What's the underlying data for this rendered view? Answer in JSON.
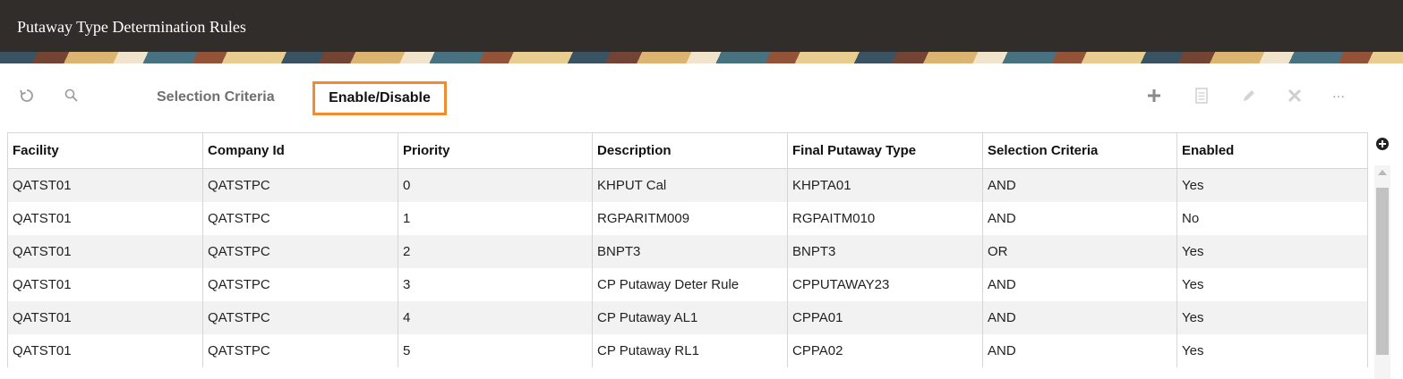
{
  "page": {
    "title": "Putaway Type Determination Rules"
  },
  "toolbar": {
    "refresh_icon": "refresh-icon",
    "search_icon": "search-icon",
    "tab_selection_criteria": "Selection Criteria",
    "tab_enable_disable": "Enable/Disable",
    "add_icon": "add-icon",
    "details_icon": "details-icon",
    "edit_icon": "edit-icon",
    "delete_icon": "delete-icon",
    "more_label": "···"
  },
  "colors": {
    "titlebar": "#312d2a",
    "active_tab_border": "#f28a2e",
    "row_stripe": "#f2f2f2"
  },
  "table": {
    "columns": [
      "Facility",
      "Company Id",
      "Priority",
      "Description",
      "Final Putaway Type",
      "Selection Criteria",
      "Enabled"
    ],
    "rows": [
      [
        "QATST01",
        "QATSTPC",
        "0",
        "KHPUT Cal",
        "KHPTA01",
        "AND",
        "Yes"
      ],
      [
        "QATST01",
        "QATSTPC",
        "1",
        "RGPARITM009",
        "RGPAITM010",
        "AND",
        "No"
      ],
      [
        "QATST01",
        "QATSTPC",
        "2",
        "BNPT3",
        "BNPT3",
        "OR",
        "Yes"
      ],
      [
        "QATST01",
        "QATSTPC",
        "3",
        "CP Putaway Deter Rule",
        "CPPUTAWAY23",
        "AND",
        "Yes"
      ],
      [
        "QATST01",
        "QATSTPC",
        "4",
        "CP Putaway AL1",
        "CPPA01",
        "AND",
        "Yes"
      ],
      [
        "QATST01",
        "QATSTPC",
        "5",
        "CP Putaway RL1",
        "CPPA02",
        "AND",
        "Yes"
      ]
    ]
  }
}
